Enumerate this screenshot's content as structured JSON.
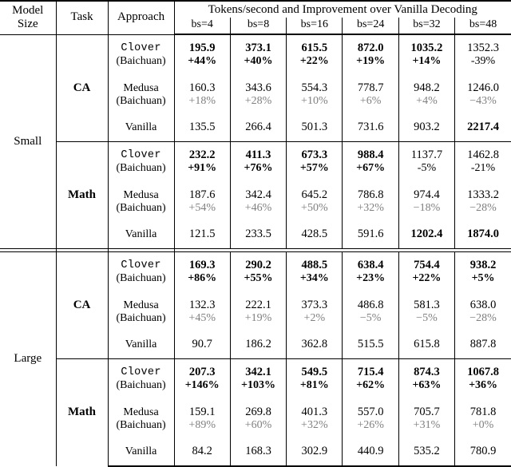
{
  "table": {
    "header": {
      "col_model_size_l1": "Model",
      "col_model_size_l2": "Size",
      "col_task": "Task",
      "col_approach": "Approach",
      "group_title": "Tokens/second and Improvement over Vanilla Decoding",
      "batch_sizes": [
        "bs=4",
        "bs=8",
        "bs=16",
        "bs=24",
        "bs=32",
        "bs=48"
      ]
    },
    "approach_names": {
      "clover": "Clover",
      "clover_sub": "(Baichuan)",
      "medusa": "Medusa",
      "medusa_sub": "(Baichuan)",
      "vanilla": "Vanilla"
    },
    "colors": {
      "medusa_pct": "#808080",
      "text": "#000000",
      "rule": "#000000"
    },
    "sections": [
      {
        "model_size": "Small",
        "tasks": [
          {
            "task": "CA",
            "rows": [
              {
                "approach": "clover",
                "values": [
                  "195.9",
                  "373.1",
                  "615.5",
                  "872.0",
                  "1035.2",
                  "1352.3"
                ],
                "pcts": [
                  "+44%",
                  "+40%",
                  "+22%",
                  "+19%",
                  "+14%",
                  "-39%"
                ],
                "bold": [
                  true,
                  true,
                  true,
                  true,
                  true,
                  false
                ]
              },
              {
                "approach": "medusa",
                "values": [
                  "160.3",
                  "343.6",
                  "554.3",
                  "778.7",
                  "948.2",
                  "1246.0"
                ],
                "pcts": [
                  "+18%",
                  "+28%",
                  "+10%",
                  "+6%",
                  "+4%",
                  "−43%"
                ],
                "bold": [
                  false,
                  false,
                  false,
                  false,
                  false,
                  false
                ]
              },
              {
                "approach": "vanilla",
                "values": [
                  "135.5",
                  "266.4",
                  "501.3",
                  "731.6",
                  "903.2",
                  "2217.4"
                ],
                "pcts": [
                  "",
                  "",
                  "",
                  "",
                  "",
                  ""
                ],
                "bold": [
                  false,
                  false,
                  false,
                  false,
                  false,
                  true
                ]
              }
            ]
          },
          {
            "task": "Math",
            "rows": [
              {
                "approach": "clover",
                "values": [
                  "232.2",
                  "411.3",
                  "673.3",
                  "988.4",
                  "1137.7",
                  "1462.8"
                ],
                "pcts": [
                  "+91%",
                  "+76%",
                  "+57%",
                  "+67%",
                  "-5%",
                  "-21%"
                ],
                "bold": [
                  true,
                  true,
                  true,
                  true,
                  false,
                  false
                ]
              },
              {
                "approach": "medusa",
                "values": [
                  "187.6",
                  "342.4",
                  "645.2",
                  "786.8",
                  "974.4",
                  "1333.2"
                ],
                "pcts": [
                  "+54%",
                  "+46%",
                  "+50%",
                  "+32%",
                  "−18%",
                  "−28%"
                ],
                "bold": [
                  false,
                  false,
                  false,
                  false,
                  false,
                  false
                ]
              },
              {
                "approach": "vanilla",
                "values": [
                  "121.5",
                  "233.5",
                  "428.5",
                  "591.6",
                  "1202.4",
                  "1874.0"
                ],
                "pcts": [
                  "",
                  "",
                  "",
                  "",
                  "",
                  ""
                ],
                "bold": [
                  false,
                  false,
                  false,
                  false,
                  true,
                  true
                ]
              }
            ]
          }
        ]
      },
      {
        "model_size": "Large",
        "tasks": [
          {
            "task": "CA",
            "rows": [
              {
                "approach": "clover",
                "values": [
                  "169.3",
                  "290.2",
                  "488.5",
                  "638.4",
                  "754.4",
                  "938.2"
                ],
                "pcts": [
                  "+86%",
                  "+55%",
                  "+34%",
                  "+23%",
                  "+22%",
                  "+5%"
                ],
                "bold": [
                  true,
                  true,
                  true,
                  true,
                  true,
                  true
                ]
              },
              {
                "approach": "medusa",
                "values": [
                  "132.3",
                  "222.1",
                  "373.3",
                  "486.8",
                  "581.3",
                  "638.0"
                ],
                "pcts": [
                  "+45%",
                  "+19%",
                  "+2%",
                  "−5%",
                  "−5%",
                  "−28%"
                ],
                "bold": [
                  false,
                  false,
                  false,
                  false,
                  false,
                  false
                ]
              },
              {
                "approach": "vanilla",
                "values": [
                  "90.7",
                  "186.2",
                  "362.8",
                  "515.5",
                  "615.8",
                  "887.8"
                ],
                "pcts": [
                  "",
                  "",
                  "",
                  "",
                  "",
                  ""
                ],
                "bold": [
                  false,
                  false,
                  false,
                  false,
                  false,
                  false
                ]
              }
            ]
          },
          {
            "task": "Math",
            "rows": [
              {
                "approach": "clover",
                "values": [
                  "207.3",
                  "342.1",
                  "549.5",
                  "715.4",
                  "874.3",
                  "1067.8"
                ],
                "pcts": [
                  "+146%",
                  "+103%",
                  "+81%",
                  "+62%",
                  "+63%",
                  "+36%"
                ],
                "bold": [
                  true,
                  true,
                  true,
                  true,
                  true,
                  true
                ]
              },
              {
                "approach": "medusa",
                "values": [
                  "159.1",
                  "269.8",
                  "401.3",
                  "557.0",
                  "705.7",
                  "781.8"
                ],
                "pcts": [
                  "+89%",
                  "+60%",
                  "+32%",
                  "+26%",
                  "+31%",
                  "+0%"
                ],
                "bold": [
                  false,
                  false,
                  false,
                  false,
                  false,
                  false
                ]
              },
              {
                "approach": "vanilla",
                "values": [
                  "84.2",
                  "168.3",
                  "302.9",
                  "440.9",
                  "535.2",
                  "780.9"
                ],
                "pcts": [
                  "",
                  "",
                  "",
                  "",
                  "",
                  ""
                ],
                "bold": [
                  false,
                  false,
                  false,
                  false,
                  false,
                  false
                ]
              }
            ]
          }
        ]
      }
    ]
  }
}
